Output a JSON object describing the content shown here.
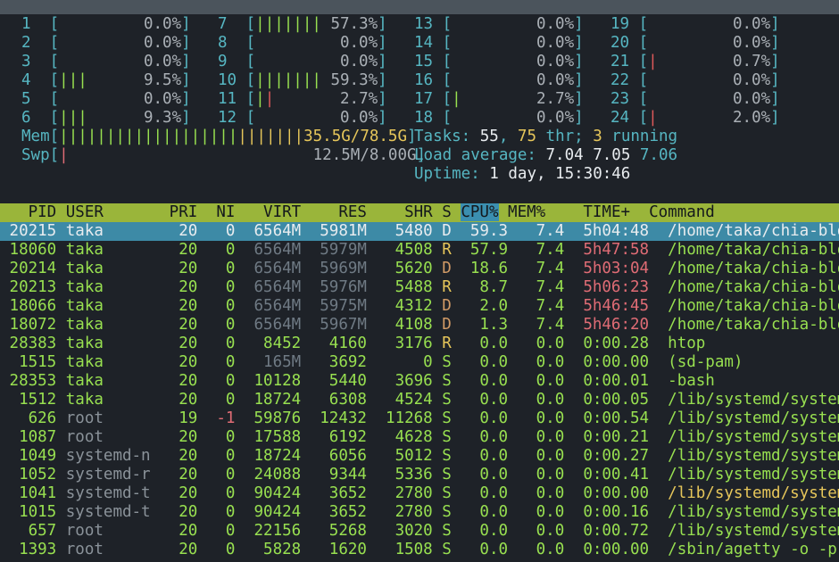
{
  "cpus": [
    {
      "id": "1",
      "bars": "",
      "bars_hi": "",
      "pct": "0.0%"
    },
    {
      "id": "2",
      "bars": "",
      "bars_hi": "",
      "pct": "0.0%"
    },
    {
      "id": "3",
      "bars": "",
      "bars_hi": "",
      "pct": "0.0%"
    },
    {
      "id": "4",
      "bars": "|||",
      "bars_hi": "",
      "pct": "9.5%"
    },
    {
      "id": "5",
      "bars": "",
      "bars_hi": "",
      "pct": "0.0%"
    },
    {
      "id": "6",
      "bars": "|||",
      "bars_hi": "",
      "pct": "9.3%"
    },
    {
      "id": "7",
      "bars": "|||||||",
      "bars_hi": "",
      "pct": "57.3%"
    },
    {
      "id": "8",
      "bars": "",
      "bars_hi": "",
      "pct": "0.0%"
    },
    {
      "id": "9",
      "bars": "",
      "bars_hi": "",
      "pct": "0.0%"
    },
    {
      "id": "10",
      "bars": "|||||||",
      "bars_hi": "",
      "pct": "59.3%"
    },
    {
      "id": "11",
      "bars": "|",
      "bars_hi": "|",
      "pct": "2.7%"
    },
    {
      "id": "12",
      "bars": "",
      "bars_hi": "",
      "pct": "0.0%"
    },
    {
      "id": "13",
      "bars": "",
      "bars_hi": "",
      "pct": "0.0%"
    },
    {
      "id": "14",
      "bars": "",
      "bars_hi": "",
      "pct": "0.0%"
    },
    {
      "id": "15",
      "bars": "",
      "bars_hi": "",
      "pct": "0.0%"
    },
    {
      "id": "16",
      "bars": "",
      "bars_hi": "",
      "pct": "0.0%"
    },
    {
      "id": "17",
      "bars": "|",
      "bars_hi": "",
      "pct": "2.7%"
    },
    {
      "id": "18",
      "bars": "",
      "bars_hi": "",
      "pct": "0.0%"
    },
    {
      "id": "19",
      "bars": "",
      "bars_hi": "",
      "pct": "0.0%"
    },
    {
      "id": "20",
      "bars": "",
      "bars_hi": "",
      "pct": "0.0%"
    },
    {
      "id": "21",
      "bars": "",
      "bars_hi": "|",
      "pct": "0.7%"
    },
    {
      "id": "22",
      "bars": "",
      "bars_hi": "",
      "pct": "0.0%"
    },
    {
      "id": "23",
      "bars": "",
      "bars_hi": "",
      "pct": "0.0%"
    },
    {
      "id": "24",
      "bars": "",
      "bars_hi": "|",
      "pct": "2.0%"
    }
  ],
  "mem": {
    "label": "Mem",
    "bars": "||||||||||||||||||||||||||",
    "value": "35.5G/78.5G"
  },
  "swp": {
    "label": "Swp",
    "bars": "|",
    "value": "12.5M/8.00G"
  },
  "tasks": {
    "label": "Tasks:",
    "count": "55",
    "thr": "75",
    "thr_label": "thr;",
    "running": "3",
    "running_label": "running"
  },
  "load": {
    "label": "Load average:",
    "l1": "7.04",
    "l5": "7.05",
    "l15": "7.06"
  },
  "uptime": {
    "label": "Uptime:",
    "value": "1 day, 15:30:46"
  },
  "columns": [
    "PID",
    "USER",
    "PRI",
    "NI",
    "VIRT",
    "RES",
    "SHR",
    "S",
    "CPU%",
    "MEM%",
    "TIME+",
    "Command"
  ],
  "processes": [
    {
      "pid": "20215",
      "user": "taka",
      "pri": "20",
      "ni": "0",
      "virt": "6564M",
      "res": "5981M",
      "shr": "5480",
      "s": "D",
      "cpu": "59.3",
      "mem": "7.4",
      "time": "5h04:48",
      "cmd": "/home/taka/chia-bloc",
      "selected": true
    },
    {
      "pid": "18060",
      "user": "taka",
      "pri": "20",
      "ni": "0",
      "virt": "6564M",
      "res": "5979M",
      "shr": "4508",
      "s": "R",
      "cpu": "57.9",
      "mem": "7.4",
      "time": "5h47:58",
      "cmd": "/home/taka/chia-bloc"
    },
    {
      "pid": "20214",
      "user": "taka",
      "pri": "20",
      "ni": "0",
      "virt": "6564M",
      "res": "5969M",
      "shr": "5620",
      "s": "D",
      "cpu": "18.6",
      "mem": "7.4",
      "time": "5h03:04",
      "cmd": "/home/taka/chia-bloc"
    },
    {
      "pid": "20213",
      "user": "taka",
      "pri": "20",
      "ni": "0",
      "virt": "6564M",
      "res": "5976M",
      "shr": "5488",
      "s": "R",
      "cpu": "8.7",
      "mem": "7.4",
      "time": "5h06:23",
      "cmd": "/home/taka/chia-bloc"
    },
    {
      "pid": "18066",
      "user": "taka",
      "pri": "20",
      "ni": "0",
      "virt": "6564M",
      "res": "5975M",
      "shr": "4312",
      "s": "D",
      "cpu": "2.0",
      "mem": "7.4",
      "time": "5h46:45",
      "cmd": "/home/taka/chia-bloc"
    },
    {
      "pid": "18072",
      "user": "taka",
      "pri": "20",
      "ni": "0",
      "virt": "6564M",
      "res": "5967M",
      "shr": "4108",
      "s": "D",
      "cpu": "1.3",
      "mem": "7.4",
      "time": "5h46:20",
      "cmd": "/home/taka/chia-bloc"
    },
    {
      "pid": "28383",
      "user": "taka",
      "pri": "20",
      "ni": "0",
      "virt": "8452",
      "res": "4160",
      "shr": "3176",
      "s": "R",
      "cpu": "0.0",
      "mem": "0.0",
      "time": "0:00.28",
      "cmd": "htop"
    },
    {
      "pid": "1515",
      "user": "taka",
      "pri": "20",
      "ni": "0",
      "virt": "165M",
      "res": "3692",
      "shr": "0",
      "s": "S",
      "cpu": "0.0",
      "mem": "0.0",
      "time": "0:00.00",
      "cmd": "(sd-pam)"
    },
    {
      "pid": "28353",
      "user": "taka",
      "pri": "20",
      "ni": "0",
      "virt": "10128",
      "res": "5440",
      "shr": "3696",
      "s": "S",
      "cpu": "0.0",
      "mem": "0.0",
      "time": "0:00.01",
      "cmd": "-bash"
    },
    {
      "pid": "1512",
      "user": "taka",
      "pri": "20",
      "ni": "0",
      "virt": "18724",
      "res": "6308",
      "shr": "4524",
      "s": "S",
      "cpu": "0.0",
      "mem": "0.0",
      "time": "0:00.05",
      "cmd": "/lib/systemd/systemd"
    },
    {
      "pid": "626",
      "user": "root",
      "pri": "19",
      "ni": "-1",
      "virt": "59876",
      "res": "12432",
      "shr": "11268",
      "s": "S",
      "cpu": "0.0",
      "mem": "0.0",
      "time": "0:00.54",
      "cmd": "/lib/systemd/systemd"
    },
    {
      "pid": "1087",
      "user": "root",
      "pri": "20",
      "ni": "0",
      "virt": "17588",
      "res": "6192",
      "shr": "4628",
      "s": "S",
      "cpu": "0.0",
      "mem": "0.0",
      "time": "0:00.21",
      "cmd": "/lib/systemd/systemd"
    },
    {
      "pid": "1049",
      "user": "systemd-n",
      "pri": "20",
      "ni": "0",
      "virt": "18724",
      "res": "6056",
      "shr": "5012",
      "s": "S",
      "cpu": "0.0",
      "mem": "0.0",
      "time": "0:00.27",
      "cmd": "/lib/systemd/systemd"
    },
    {
      "pid": "1052",
      "user": "systemd-r",
      "pri": "20",
      "ni": "0",
      "virt": "24088",
      "res": "9344",
      "shr": "5336",
      "s": "S",
      "cpu": "0.0",
      "mem": "0.0",
      "time": "0:00.41",
      "cmd": "/lib/systemd/systemd"
    },
    {
      "pid": "1041",
      "user": "systemd-t",
      "pri": "20",
      "ni": "0",
      "virt": "90424",
      "res": "3652",
      "shr": "2780",
      "s": "S",
      "cpu": "0.0",
      "mem": "0.0",
      "time": "0:00.00",
      "cmd": "/lib/systemd/systemd",
      "thread": true
    },
    {
      "pid": "1015",
      "user": "systemd-t",
      "pri": "20",
      "ni": "0",
      "virt": "90424",
      "res": "3652",
      "shr": "2780",
      "s": "S",
      "cpu": "0.0",
      "mem": "0.0",
      "time": "0:00.16",
      "cmd": "/lib/systemd/systemd"
    },
    {
      "pid": "657",
      "user": "root",
      "pri": "20",
      "ni": "0",
      "virt": "22156",
      "res": "5268",
      "shr": "3020",
      "s": "S",
      "cpu": "0.0",
      "mem": "0.0",
      "time": "0:00.72",
      "cmd": "/lib/systemd/systemd"
    },
    {
      "pid": "1393",
      "user": "root",
      "pri": "20",
      "ni": "0",
      "virt": "5828",
      "res": "1620",
      "shr": "1508",
      "s": "S",
      "cpu": "0.0",
      "mem": "0.0",
      "time": "0:00.00",
      "cmd": "/sbin/agetty -o -p -"
    }
  ],
  "colors": {
    "bg": "#1e2228",
    "header_bg": "#9ab53a",
    "cpu_col_bg": "#3b8fb0",
    "selected_bg": "#3d8aa6",
    "green": "#98e050",
    "cyan": "#56b6c2",
    "red": "#e05a5a",
    "yellow": "#e6c65a"
  }
}
